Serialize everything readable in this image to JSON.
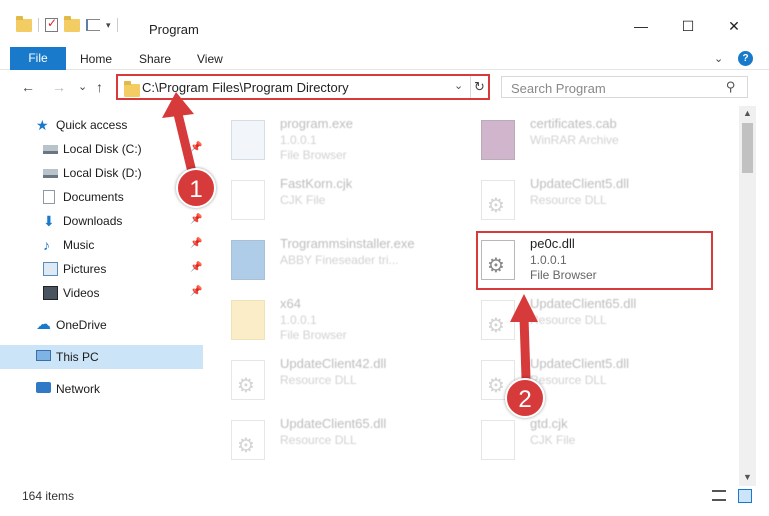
{
  "window": {
    "title": "Program",
    "minimize_glyph": "—",
    "maximize_glyph": "☐",
    "close_glyph": "✕"
  },
  "ribbon": {
    "file_label": "File",
    "tabs": [
      "Home",
      "Share",
      "View"
    ],
    "help_glyph": "?"
  },
  "nav": {
    "back": "←",
    "forward": "→",
    "recent": "⌄",
    "up": "↑",
    "address": "C:\\Program Files\\Program Directory",
    "address_dropdown": "⌄",
    "refresh": "↻",
    "search_placeholder": "Search Program",
    "search_glyph": "⚲"
  },
  "sidebar": {
    "items": [
      {
        "label": "Quick access",
        "icon": "star-icon"
      },
      {
        "label": "Local Disk (C:)",
        "icon": "disk-icon"
      },
      {
        "label": "Local Disk (D:)",
        "icon": "disk-icon"
      },
      {
        "label": "Documents",
        "icon": "documents-icon"
      },
      {
        "label": "Downloads",
        "icon": "downloads-icon"
      },
      {
        "label": "Music",
        "icon": "music-icon"
      },
      {
        "label": "Pictures",
        "icon": "pictures-icon"
      },
      {
        "label": "Videos",
        "icon": "videos-icon"
      },
      {
        "label": "OneDrive",
        "icon": "cloud-icon"
      },
      {
        "label": "This PC",
        "icon": "pc-icon"
      },
      {
        "label": "Network",
        "icon": "network-icon"
      }
    ],
    "pin_glyph": "📌"
  },
  "files": [
    {
      "name": "program.exe",
      "line1": "1.0.0.1",
      "line2": "File Browser",
      "icon": "exe"
    },
    {
      "name": "certificates.cab",
      "line1": "WinRAR Archive",
      "line2": "",
      "icon": "cab"
    },
    {
      "name": "FastKorn.cjk",
      "line1": "CJK File",
      "line2": "",
      "icon": "page"
    },
    {
      "name": "UpdateClient5.dll",
      "line1": "Resource DLL",
      "line2": "",
      "icon": "dll"
    },
    {
      "name": "Trogrammsinstaller.exe",
      "line1": "ABBY Fineseader tri...",
      "line2": "",
      "icon": "inst"
    },
    {
      "name": "pe0c.dll",
      "line1": "1.0.0.1",
      "line2": "File Browser",
      "icon": "dll"
    },
    {
      "name": "x64",
      "line1": "1.0.0.1",
      "line2": "File Browser",
      "icon": "folder"
    },
    {
      "name": "UpdateClient65.dll",
      "line1": "Resource DLL",
      "line2": "",
      "icon": "dll"
    },
    {
      "name": "UpdateClient42.dll",
      "line1": "Resource DLL",
      "line2": "",
      "icon": "dll"
    },
    {
      "name": "UpdateClient5.dll",
      "line1": "Resource DLL",
      "line2": "",
      "icon": "dll"
    },
    {
      "name": "UpdateClient65.dll",
      "line1": "Resource DLL",
      "line2": "",
      "icon": "dll"
    },
    {
      "name": "gtd.cjk",
      "line1": "CJK File",
      "line2": "",
      "icon": "page"
    }
  ],
  "status": {
    "count": "164 items"
  },
  "callouts": {
    "one": "1",
    "two": "2"
  },
  "colors": {
    "accent": "#1979ca",
    "highlight_red": "#d73a3a",
    "selected_bg": "#cce4f7"
  }
}
